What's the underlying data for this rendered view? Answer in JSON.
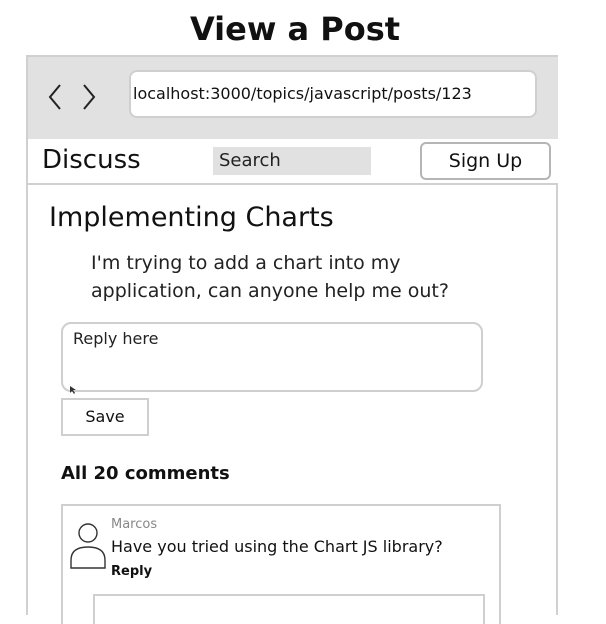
{
  "page": {
    "title": "View a Post"
  },
  "browser": {
    "url": "localhost:3000/topics/javascript/posts/123"
  },
  "header": {
    "brand": "Discuss",
    "search_placeholder": "Search",
    "signup_label": "Sign Up"
  },
  "post": {
    "title": "Implementing Charts",
    "body": "I'm trying to add a chart into my application, can anyone help me out?"
  },
  "reply": {
    "placeholder": "Reply here",
    "save_label": "Save"
  },
  "comments": {
    "heading": "All 20 comments",
    "items": [
      {
        "author": "Marcos",
        "text": "Have you tried using the Chart JS library?",
        "reply_label": "Reply"
      }
    ]
  },
  "icons": {
    "back": "chevron-left-icon",
    "forward": "chevron-right-icon",
    "avatar": "user-icon",
    "cursor": "mouse-pointer-icon"
  }
}
